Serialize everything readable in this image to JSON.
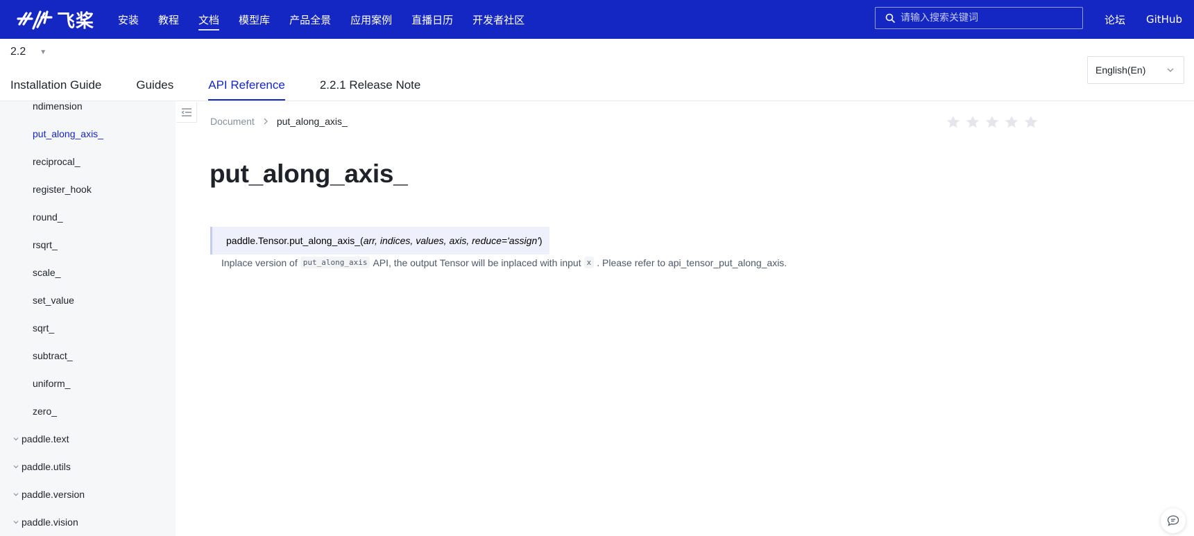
{
  "topnav": {
    "logo_text": "飞桨",
    "items": [
      {
        "label": "安装"
      },
      {
        "label": "教程"
      },
      {
        "label": "文档",
        "active": true
      },
      {
        "label": "模型库"
      },
      {
        "label": "产品全景"
      },
      {
        "label": "应用案例"
      },
      {
        "label": "直播日历"
      },
      {
        "label": "开发者社区"
      }
    ],
    "search_placeholder": "请输入搜索关键词",
    "forum_label": "论坛",
    "github_label": "GitHub"
  },
  "subheader": {
    "version": "2.2",
    "tabs": [
      {
        "label": "Installation Guide"
      },
      {
        "label": "Guides"
      },
      {
        "label": "API Reference",
        "active": true
      },
      {
        "label": "2.2.1 Release Note"
      }
    ],
    "language": "English(En)"
  },
  "sidebar": {
    "items": [
      {
        "label": "ndimension"
      },
      {
        "label": "put_along_axis_",
        "active": true
      },
      {
        "label": "reciprocal_"
      },
      {
        "label": "register_hook"
      },
      {
        "label": "round_"
      },
      {
        "label": "rsqrt_"
      },
      {
        "label": "scale_"
      },
      {
        "label": "set_value"
      },
      {
        "label": "sqrt_"
      },
      {
        "label": "subtract_"
      },
      {
        "label": "uniform_"
      },
      {
        "label": "zero_"
      }
    ],
    "groups": [
      {
        "label": "paddle.text"
      },
      {
        "label": "paddle.utils"
      },
      {
        "label": "paddle.version"
      },
      {
        "label": "paddle.vision"
      }
    ]
  },
  "main": {
    "breadcrumb": {
      "root": "Document",
      "current": "put_along_axis_"
    },
    "rating": {
      "filled": 0,
      "max": 5
    },
    "title": "put_along_axis_",
    "signature": {
      "prefix": "paddle.Tensor.put_along_axis_",
      "open_paren": "(",
      "params": "arr, indices, values, axis, reduce='assign'",
      "close_paren": ")"
    },
    "description": {
      "before": "Inplace version of",
      "code1": "put_along_axis",
      "middle": "API, the output Tensor will be inplaced with input",
      "code2": "x",
      "after": ". Please refer to api_tensor_put_along_axis."
    }
  },
  "colors": {
    "brand": "#1527c2",
    "sidebar_bg": "#f6f7f9"
  }
}
